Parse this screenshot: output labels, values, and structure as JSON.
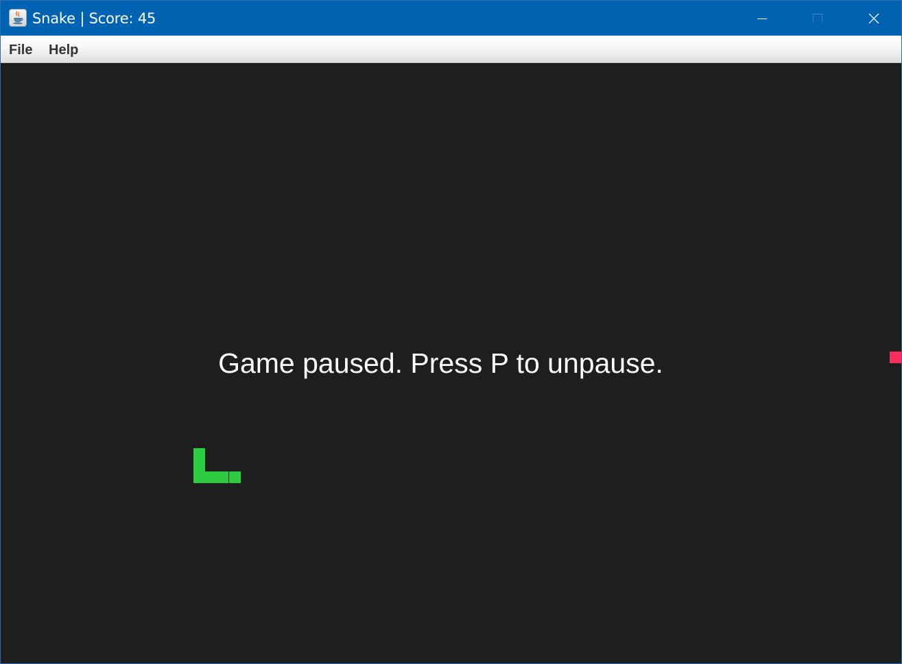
{
  "window": {
    "title": "Snake | Score: 45",
    "icon": "java-icon"
  },
  "menu": {
    "file_label": "File",
    "help_label": "Help"
  },
  "game": {
    "score": 45,
    "status_message": "Game paused. Press P to unpause.",
    "colors": {
      "background": "#1e1e1e",
      "snake": "#2ecc40",
      "food": "#ff2e5c"
    }
  }
}
